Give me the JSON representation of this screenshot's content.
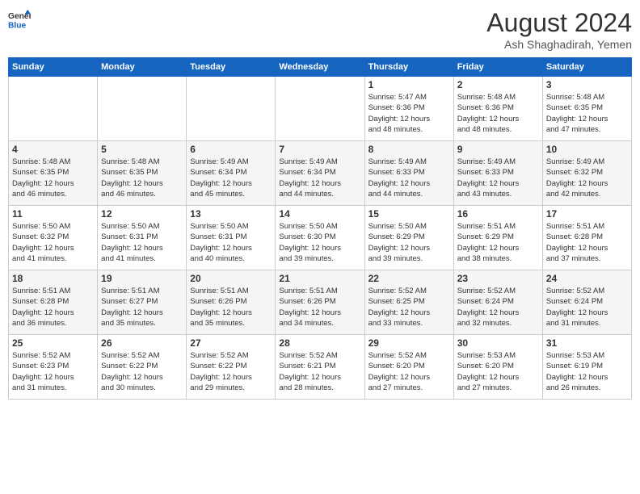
{
  "header": {
    "logo_line1": "General",
    "logo_line2": "Blue",
    "title": "August 2024",
    "subtitle": "Ash Shaghadirah, Yemen"
  },
  "days_of_week": [
    "Sunday",
    "Monday",
    "Tuesday",
    "Wednesday",
    "Thursday",
    "Friday",
    "Saturday"
  ],
  "weeks": [
    [
      {
        "day": "",
        "info": ""
      },
      {
        "day": "",
        "info": ""
      },
      {
        "day": "",
        "info": ""
      },
      {
        "day": "",
        "info": ""
      },
      {
        "day": "1",
        "info": "Sunrise: 5:47 AM\nSunset: 6:36 PM\nDaylight: 12 hours\nand 48 minutes."
      },
      {
        "day": "2",
        "info": "Sunrise: 5:48 AM\nSunset: 6:36 PM\nDaylight: 12 hours\nand 48 minutes."
      },
      {
        "day": "3",
        "info": "Sunrise: 5:48 AM\nSunset: 6:35 PM\nDaylight: 12 hours\nand 47 minutes."
      }
    ],
    [
      {
        "day": "4",
        "info": "Sunrise: 5:48 AM\nSunset: 6:35 PM\nDaylight: 12 hours\nand 46 minutes."
      },
      {
        "day": "5",
        "info": "Sunrise: 5:48 AM\nSunset: 6:35 PM\nDaylight: 12 hours\nand 46 minutes."
      },
      {
        "day": "6",
        "info": "Sunrise: 5:49 AM\nSunset: 6:34 PM\nDaylight: 12 hours\nand 45 minutes."
      },
      {
        "day": "7",
        "info": "Sunrise: 5:49 AM\nSunset: 6:34 PM\nDaylight: 12 hours\nand 44 minutes."
      },
      {
        "day": "8",
        "info": "Sunrise: 5:49 AM\nSunset: 6:33 PM\nDaylight: 12 hours\nand 44 minutes."
      },
      {
        "day": "9",
        "info": "Sunrise: 5:49 AM\nSunset: 6:33 PM\nDaylight: 12 hours\nand 43 minutes."
      },
      {
        "day": "10",
        "info": "Sunrise: 5:49 AM\nSunset: 6:32 PM\nDaylight: 12 hours\nand 42 minutes."
      }
    ],
    [
      {
        "day": "11",
        "info": "Sunrise: 5:50 AM\nSunset: 6:32 PM\nDaylight: 12 hours\nand 41 minutes."
      },
      {
        "day": "12",
        "info": "Sunrise: 5:50 AM\nSunset: 6:31 PM\nDaylight: 12 hours\nand 41 minutes."
      },
      {
        "day": "13",
        "info": "Sunrise: 5:50 AM\nSunset: 6:31 PM\nDaylight: 12 hours\nand 40 minutes."
      },
      {
        "day": "14",
        "info": "Sunrise: 5:50 AM\nSunset: 6:30 PM\nDaylight: 12 hours\nand 39 minutes."
      },
      {
        "day": "15",
        "info": "Sunrise: 5:50 AM\nSunset: 6:29 PM\nDaylight: 12 hours\nand 39 minutes."
      },
      {
        "day": "16",
        "info": "Sunrise: 5:51 AM\nSunset: 6:29 PM\nDaylight: 12 hours\nand 38 minutes."
      },
      {
        "day": "17",
        "info": "Sunrise: 5:51 AM\nSunset: 6:28 PM\nDaylight: 12 hours\nand 37 minutes."
      }
    ],
    [
      {
        "day": "18",
        "info": "Sunrise: 5:51 AM\nSunset: 6:28 PM\nDaylight: 12 hours\nand 36 minutes."
      },
      {
        "day": "19",
        "info": "Sunrise: 5:51 AM\nSunset: 6:27 PM\nDaylight: 12 hours\nand 35 minutes."
      },
      {
        "day": "20",
        "info": "Sunrise: 5:51 AM\nSunset: 6:26 PM\nDaylight: 12 hours\nand 35 minutes."
      },
      {
        "day": "21",
        "info": "Sunrise: 5:51 AM\nSunset: 6:26 PM\nDaylight: 12 hours\nand 34 minutes."
      },
      {
        "day": "22",
        "info": "Sunrise: 5:52 AM\nSunset: 6:25 PM\nDaylight: 12 hours\nand 33 minutes."
      },
      {
        "day": "23",
        "info": "Sunrise: 5:52 AM\nSunset: 6:24 PM\nDaylight: 12 hours\nand 32 minutes."
      },
      {
        "day": "24",
        "info": "Sunrise: 5:52 AM\nSunset: 6:24 PM\nDaylight: 12 hours\nand 31 minutes."
      }
    ],
    [
      {
        "day": "25",
        "info": "Sunrise: 5:52 AM\nSunset: 6:23 PM\nDaylight: 12 hours\nand 31 minutes."
      },
      {
        "day": "26",
        "info": "Sunrise: 5:52 AM\nSunset: 6:22 PM\nDaylight: 12 hours\nand 30 minutes."
      },
      {
        "day": "27",
        "info": "Sunrise: 5:52 AM\nSunset: 6:22 PM\nDaylight: 12 hours\nand 29 minutes."
      },
      {
        "day": "28",
        "info": "Sunrise: 5:52 AM\nSunset: 6:21 PM\nDaylight: 12 hours\nand 28 minutes."
      },
      {
        "day": "29",
        "info": "Sunrise: 5:52 AM\nSunset: 6:20 PM\nDaylight: 12 hours\nand 27 minutes."
      },
      {
        "day": "30",
        "info": "Sunrise: 5:53 AM\nSunset: 6:20 PM\nDaylight: 12 hours\nand 27 minutes."
      },
      {
        "day": "31",
        "info": "Sunrise: 5:53 AM\nSunset: 6:19 PM\nDaylight: 12 hours\nand 26 minutes."
      }
    ]
  ]
}
